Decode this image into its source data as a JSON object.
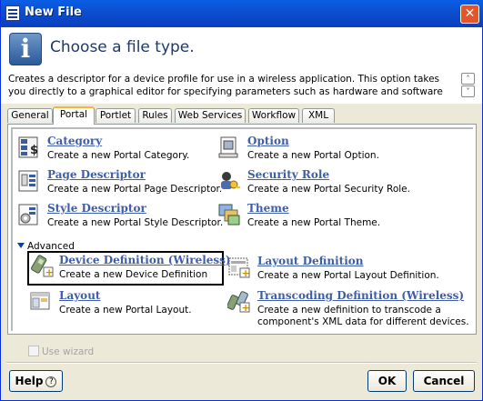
{
  "window": {
    "title": "New File",
    "close_glyph": "✕"
  },
  "header": {
    "title": "Choose a file type.",
    "info_glyph": "i"
  },
  "description": "Creates a descriptor for a device profile for use in a wireless application. This option takes you directly to a graphical editor for specifying parameters such as hardware and software",
  "scroll": {
    "up": "˄",
    "down": "˅"
  },
  "tabs": [
    {
      "label": "General",
      "active": false
    },
    {
      "label": "Portal",
      "active": true
    },
    {
      "label": "Portlet",
      "active": false
    },
    {
      "label": "Rules",
      "active": false
    },
    {
      "label": "Web Services",
      "active": false
    },
    {
      "label": "Workflow",
      "active": false
    },
    {
      "label": "XML",
      "active": false
    }
  ],
  "items": [
    {
      "name": "Category",
      "desc": "Create a new Portal Category.",
      "icon": "category-icon"
    },
    {
      "name": "Option",
      "desc": "Create a new Portal Option.",
      "icon": "option-icon"
    },
    {
      "name": "Page Descriptor",
      "desc": "Create a new Portal Page Descriptor.",
      "icon": "page-descriptor-icon"
    },
    {
      "name": "Security Role",
      "desc": "Create a new Portal Security Role.",
      "icon": "security-role-icon"
    },
    {
      "name": "Style Descriptor",
      "desc": "Create a new Portal Style Descriptor.",
      "icon": "style-descriptor-icon"
    },
    {
      "name": "Theme",
      "desc": "Create a new Portal Theme.",
      "icon": "theme-icon"
    }
  ],
  "advanced": {
    "label": "Advanced",
    "items": [
      {
        "name": "Device Definition (Wireless)",
        "desc": "Create a new Device Definition",
        "icon": "device-definition-icon",
        "selected": true
      },
      {
        "name": "Layout Definition",
        "desc": "Create a new Portal Layout Definition.",
        "icon": "layout-definition-icon"
      },
      {
        "name": "Layout",
        "desc": "Create a new Portal Layout.",
        "icon": "layout-icon"
      },
      {
        "name": "Transcoding Definition (Wireless)",
        "desc_line1": "Create a new definition to transcode a",
        "desc_line2": "component's XML data for different devices.",
        "icon": "transcoding-definition-icon"
      }
    ]
  },
  "wizard": {
    "label": "Use wizard",
    "checked": false,
    "enabled": false
  },
  "buttons": {
    "help": "Help",
    "help_glyph": "?",
    "ok": "OK",
    "cancel": "Cancel"
  }
}
